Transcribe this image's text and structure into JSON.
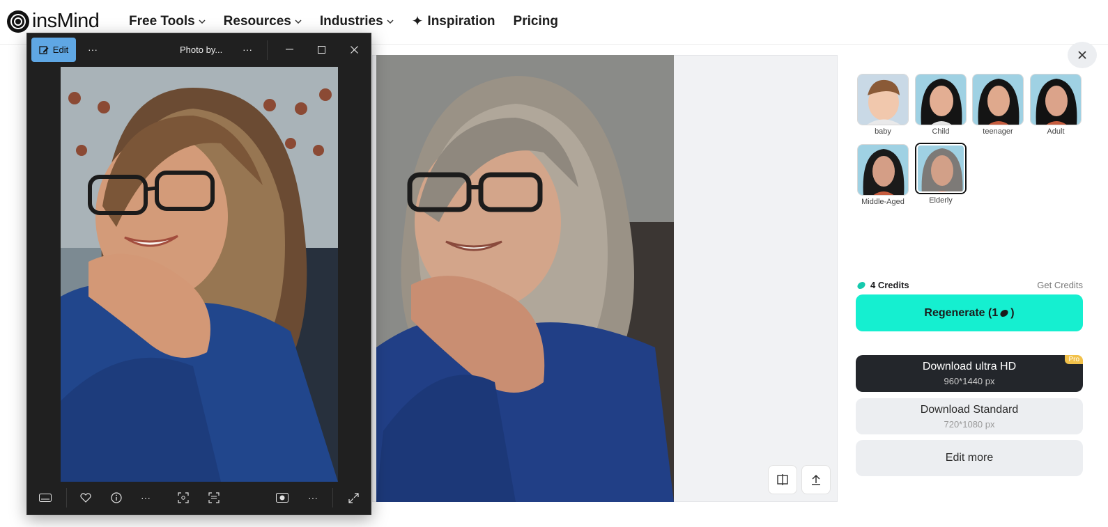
{
  "app": {
    "logo_text": "insMind",
    "nav": [
      {
        "label": "Free Tools",
        "has_dropdown": true
      },
      {
        "label": "Resources",
        "has_dropdown": true
      },
      {
        "label": "Industries",
        "has_dropdown": true
      },
      {
        "label": "Inspiration",
        "has_dropdown": false,
        "icon": "sparkle-icon"
      },
      {
        "label": "Pricing",
        "has_dropdown": false
      }
    ]
  },
  "viewer": {
    "edit_label": "Edit",
    "title": "Photo by...",
    "toolbar_icons": [
      "more-icon",
      "minimize-icon",
      "maximize-icon",
      "close-icon"
    ],
    "footer_icons": [
      "filmstrip-icon",
      "heart-icon",
      "info-icon",
      "more-icon",
      "crop-icon",
      "text-scan-icon",
      "background-icon",
      "more-icon",
      "fullscreen-icon"
    ]
  },
  "ages": [
    {
      "label": "baby",
      "selected": false
    },
    {
      "label": "Child",
      "selected": false
    },
    {
      "label": "teenager",
      "selected": false
    },
    {
      "label": "Adult",
      "selected": false
    },
    {
      "label": "Middle-Aged",
      "selected": false
    },
    {
      "label": "Elderly",
      "selected": true
    }
  ],
  "credits": {
    "label": "4 Credits",
    "get_label": "Get Credits"
  },
  "actions": {
    "regenerate": "Regenerate (1 ",
    "regenerate_close": ")",
    "hd_title": "Download ultra HD",
    "hd_size": "960*1440 px",
    "pro_badge": "Pro",
    "std_title": "Download Standard",
    "std_size": "720*1080 px",
    "edit_more": "Edit more"
  },
  "colors": {
    "accent": "#15efd0",
    "dark_button": "#23262b",
    "pro_badge": "#f2c14a",
    "viewer_bg": "#202020",
    "edit_button": "#5fa7e4"
  }
}
